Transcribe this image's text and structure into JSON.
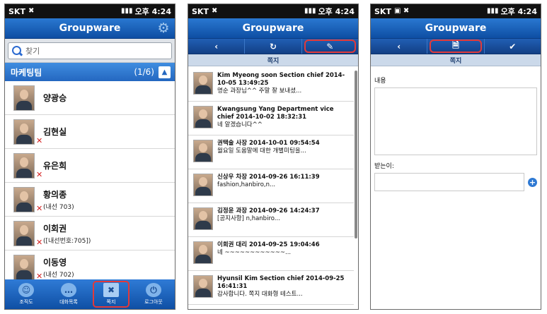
{
  "status": {
    "carrier": "SKT",
    "time": "오후 4:24"
  },
  "app_title": "Groupware",
  "screen1": {
    "search_placeholder": "찾기",
    "group": {
      "name": "마케팅팀",
      "count": "(1/6)"
    },
    "contacts": [
      {
        "name": "양광승",
        "ext": "",
        "offline": false
      },
      {
        "name": "김현실",
        "ext": "",
        "offline": true
      },
      {
        "name": "유은희",
        "ext": "",
        "offline": true
      },
      {
        "name": "황의종",
        "ext": "(내선 703)",
        "offline": true
      },
      {
        "name": "이회권",
        "ext": "([내선번호:705])",
        "offline": true
      },
      {
        "name": "이동영",
        "ext": "(내선 702)",
        "offline": true
      }
    ],
    "tabs": [
      {
        "label": "조직도",
        "icon": "people-icon"
      },
      {
        "label": "대화목록",
        "icon": "chat-bubble-icon"
      },
      {
        "label": "쪽지",
        "icon": "note-icon"
      },
      {
        "label": "로그아웃",
        "icon": "power-icon"
      }
    ]
  },
  "screen2": {
    "section": "쪽지",
    "messages": [
      {
        "header": "Kim Myeong soon Section chief 2014-10-05 13:49:25",
        "preview": "명순 과장님^^ 주말 잘 보내셨..."
      },
      {
        "header": "Kwangsung Yang Department vice chief 2014-10-02 18:32:31",
        "preview": "네 알겠습니다^^"
      },
      {
        "header": "권택술 사장 2014-10-01 09:54:54",
        "preview": "월요일 도움말에 대한 개별미팅을..."
      },
      {
        "header": "신상우 차장 2014-09-26 16:11:39",
        "preview": "fashion,hanbiro,n..."
      },
      {
        "header": "김정윤 과장 2014-09-26 14:24:37",
        "preview": "[공지사항] n,hanbiro..."
      },
      {
        "header": "이회권 대리 2014-09-25 19:04:46",
        "preview": "네 ~~~~~~~~~~~~..."
      },
      {
        "header": "Hyunsil Kim Section chief 2014-09-25 16:41:31",
        "preview": "감사합니다. 쪽지 대화형 테스트..."
      }
    ]
  },
  "screen3": {
    "section": "쪽지",
    "content_label": "내용",
    "receiver_label": "받는이:"
  },
  "icons": {
    "back": "‹",
    "refresh": "↻",
    "edit": "✎",
    "new_doc": "🗎",
    "check": "✔",
    "gear": "⚙",
    "collapse": "▲"
  }
}
